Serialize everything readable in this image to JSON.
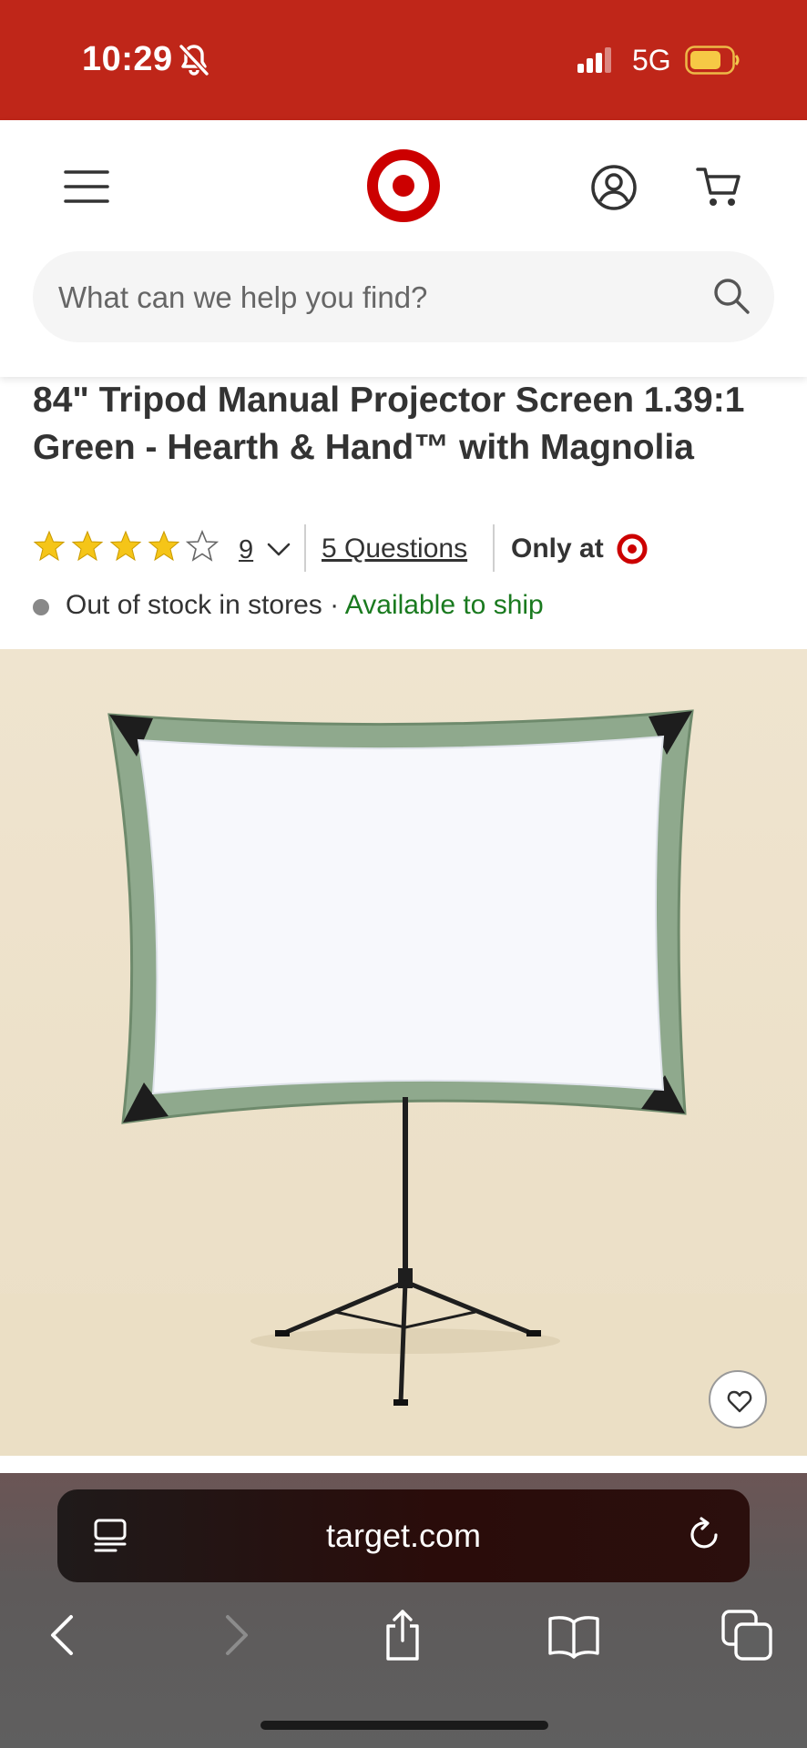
{
  "status_bar": {
    "time": "10:29",
    "network": "5G",
    "icons": [
      "bell-slash-icon",
      "signal-icon",
      "battery-icon"
    ],
    "background_color": "#bf2619"
  },
  "header": {
    "icons": [
      "menu-icon",
      "target-logo",
      "account-icon",
      "cart-icon"
    ],
    "search_placeholder": "What can we help you find?"
  },
  "product": {
    "title": "84\" Tripod Manual Projector Screen 1.39:1 Green - Hearth & Hand™ with Magnolia",
    "rating_value": 4,
    "rating_max": 5,
    "rating_count": "9",
    "questions_label": "5 Questions",
    "only_at_label": "Only at",
    "stock_status": "Out of stock in stores",
    "stock_separator": " · ",
    "shipping_status": "Available to ship",
    "shipping_color": "#1a7a1f",
    "brand_color": "#cc0000"
  },
  "browser": {
    "url": "target.com",
    "icons": [
      "page-menu-icon",
      "reload-icon",
      "back-icon",
      "forward-icon",
      "share-icon",
      "bookmarks-icon",
      "tabs-icon"
    ]
  }
}
